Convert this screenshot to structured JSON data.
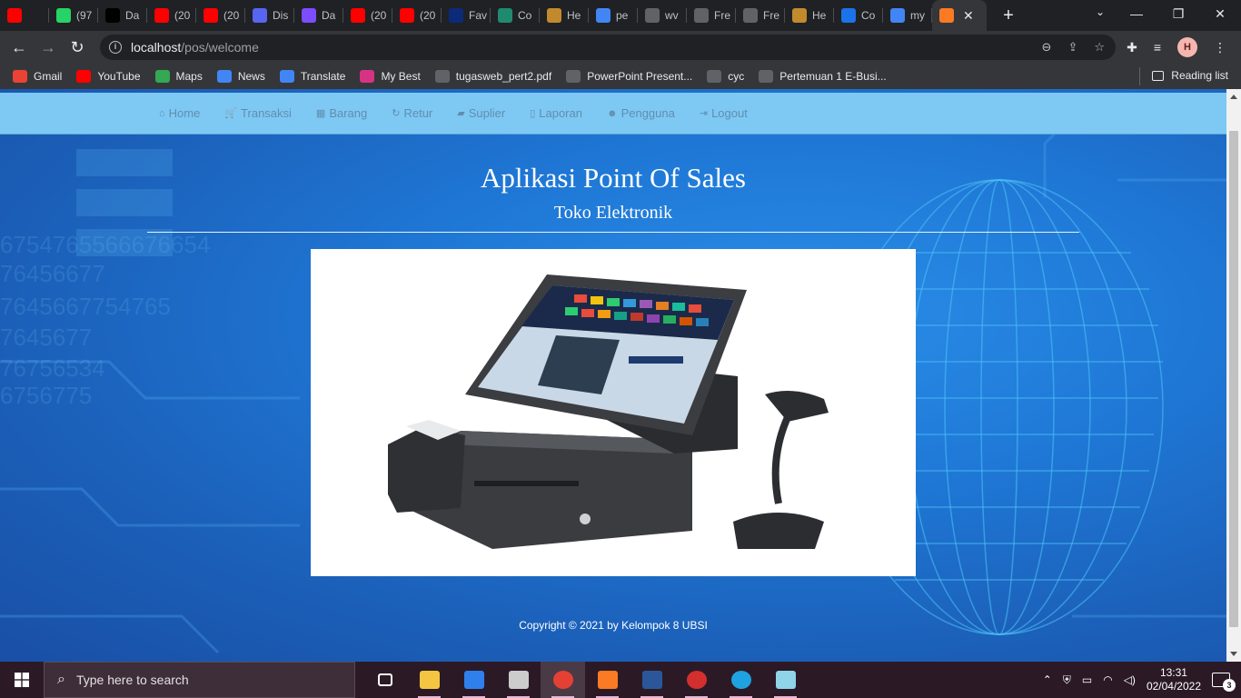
{
  "browser": {
    "tabs": [
      {
        "label": "",
        "icon": "youtube-icon",
        "color": "#ff0000"
      },
      {
        "label": "(97",
        "icon": "whatsapp-icon",
        "color": "#25d366"
      },
      {
        "label": "Da",
        "icon": "tiktok-icon",
        "color": "#000000"
      },
      {
        "label": "(20",
        "icon": "youtube-icon",
        "color": "#ff0000"
      },
      {
        "label": "(20",
        "icon": "youtube-icon",
        "color": "#ff0000"
      },
      {
        "label": "Dis",
        "icon": "discord-icon",
        "color": "#5865f2"
      },
      {
        "label": "Da",
        "icon": "list-icon",
        "color": "#7c4dff"
      },
      {
        "label": "(20",
        "icon": "youtube-icon",
        "color": "#ff0000"
      },
      {
        "label": "(20",
        "icon": "youtube-icon",
        "color": "#ff0000"
      },
      {
        "label": "Fav",
        "icon": "dans-icon",
        "color": "#0b2a7a"
      },
      {
        "label": "Co",
        "icon": "leaf-icon",
        "color": "#1f8a70"
      },
      {
        "label": "He",
        "icon": "image-icon",
        "color": "#c08a2d"
      },
      {
        "label": "pe",
        "icon": "google-icon",
        "color": "#4285f4"
      },
      {
        "label": "wv",
        "icon": "globe-icon",
        "color": "#5f6368"
      },
      {
        "label": "Fre",
        "icon": "globe-icon",
        "color": "#5f6368"
      },
      {
        "label": "Fre",
        "icon": "globe-icon",
        "color": "#5f6368"
      },
      {
        "label": "He",
        "icon": "image-icon",
        "color": "#c08a2d"
      },
      {
        "label": "Co",
        "icon": "chrome-icon",
        "color": "#1a73e8"
      },
      {
        "label": "my",
        "icon": "google-icon",
        "color": "#4285f4"
      }
    ],
    "active_tab_icon": "xampp-icon",
    "url_host": "localhost",
    "url_path": "/pos/welcome",
    "profile_initial": "H",
    "bookmarks": [
      {
        "label": "Gmail",
        "icon": "gmail-icon",
        "color": "#ea4335"
      },
      {
        "label": "YouTube",
        "icon": "youtube-icon",
        "color": "#ff0000"
      },
      {
        "label": "Maps",
        "icon": "maps-icon",
        "color": "#34a853"
      },
      {
        "label": "News",
        "icon": "news-icon",
        "color": "#4285f4"
      },
      {
        "label": "Translate",
        "icon": "translate-icon",
        "color": "#4285f4"
      },
      {
        "label": "My Best",
        "icon": "mybest-icon",
        "color": "#d63384"
      },
      {
        "label": "tugasweb_pert2.pdf",
        "icon": "globe-icon",
        "color": "#5f6368"
      },
      {
        "label": "PowerPoint Present...",
        "icon": "globe-icon",
        "color": "#5f6368"
      },
      {
        "label": "cyc",
        "icon": "globe-icon",
        "color": "#5f6368"
      },
      {
        "label": "Pertemuan 1 E-Busi...",
        "icon": "globe-icon",
        "color": "#5f6368"
      }
    ],
    "reading_list": "Reading list"
  },
  "page": {
    "nav": [
      {
        "label": "Home",
        "icon": "home-icon",
        "glyph": "⌂"
      },
      {
        "label": "Transaksi",
        "icon": "cart-icon",
        "glyph": "🛒"
      },
      {
        "label": "Barang",
        "icon": "cubes-icon",
        "glyph": "▦"
      },
      {
        "label": "Retur",
        "icon": "refresh-icon",
        "glyph": "↻"
      },
      {
        "label": "Suplier",
        "icon": "truck-icon",
        "glyph": "▰"
      },
      {
        "label": "Laporan",
        "icon": "file-icon",
        "glyph": "▯"
      },
      {
        "label": "Pengguna",
        "icon": "users-icon",
        "glyph": "☻"
      },
      {
        "label": "Logout",
        "icon": "logout-icon",
        "glyph": "⇥"
      }
    ],
    "title": "Aplikasi Point Of Sales",
    "subtitle": "Toko Elektronik",
    "copyright": "Copyright © 2021 by Kelompok 8 UBSI"
  },
  "taskbar": {
    "search_placeholder": "Type here to search",
    "apps": [
      {
        "icon": "task-view-icon"
      },
      {
        "icon": "file-explorer-icon"
      },
      {
        "icon": "vscode-icon"
      },
      {
        "icon": "terminal-icon"
      },
      {
        "icon": "chrome-icon"
      },
      {
        "icon": "xampp-icon"
      },
      {
        "icon": "word-icon"
      },
      {
        "icon": "record-icon"
      },
      {
        "icon": "edge-icon"
      },
      {
        "icon": "notes-icon"
      }
    ],
    "time": "13:31",
    "date": "02/04/2022",
    "notifications": "3"
  }
}
